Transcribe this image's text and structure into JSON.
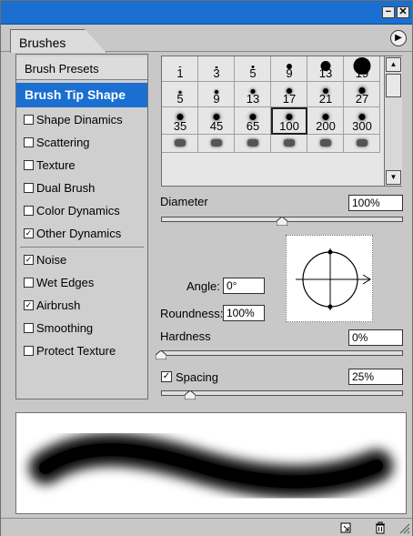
{
  "window": {
    "minimize_glyph": "−",
    "close_glyph": "✕",
    "tab_title": "Brushes",
    "menu_glyph": "▶"
  },
  "sidebar": {
    "items": [
      {
        "label": "Brush Presets",
        "checkbox": false
      },
      {
        "label": "Brush Tip Shape",
        "checkbox": false,
        "selected": true
      },
      {
        "label": "Shape Dinamics",
        "checkbox": true,
        "checked": false
      },
      {
        "label": "Scattering",
        "checkbox": true,
        "checked": false
      },
      {
        "label": "Texture",
        "checkbox": true,
        "checked": false
      },
      {
        "label": "Dual Brush",
        "checkbox": true,
        "checked": false
      },
      {
        "label": "Color Dynamics",
        "checkbox": true,
        "checked": false
      },
      {
        "label": "Other Dynamics",
        "checkbox": true,
        "checked": true
      },
      {
        "label": "Noise",
        "checkbox": true,
        "checked": true
      },
      {
        "label": "Wet Edges",
        "checkbox": true,
        "checked": false
      },
      {
        "label": "Airbrush",
        "checkbox": true,
        "checked": true
      },
      {
        "label": "Smoothing",
        "checkbox": true,
        "checked": false
      },
      {
        "label": "Protect Texture",
        "checkbox": true,
        "checked": false
      }
    ]
  },
  "brush_grid": {
    "rows": [
      [
        "1",
        "3",
        "5",
        "9",
        "13",
        "19"
      ],
      [
        "5",
        "9",
        "13",
        "17",
        "21",
        "27"
      ],
      [
        "35",
        "45",
        "65",
        "100",
        "200",
        "300"
      ],
      [
        "",
        "",
        "",
        "",
        "",
        ""
      ]
    ],
    "selected_value": "100"
  },
  "diameter": {
    "label": "Diameter",
    "value": "100%",
    "slider_percent": 50
  },
  "angle": {
    "label": "Angle:",
    "value": "0°"
  },
  "roundness": {
    "label": "Roundness:",
    "value": "100%"
  },
  "hardness": {
    "label": "Hardness",
    "value": "0%",
    "slider_percent": 0
  },
  "spacing": {
    "label": "Spacing",
    "value": "25%",
    "checked": true,
    "slider_percent": 12
  },
  "colors": {
    "accent": "#1a6fd0",
    "panel": "#c8c8c8"
  }
}
